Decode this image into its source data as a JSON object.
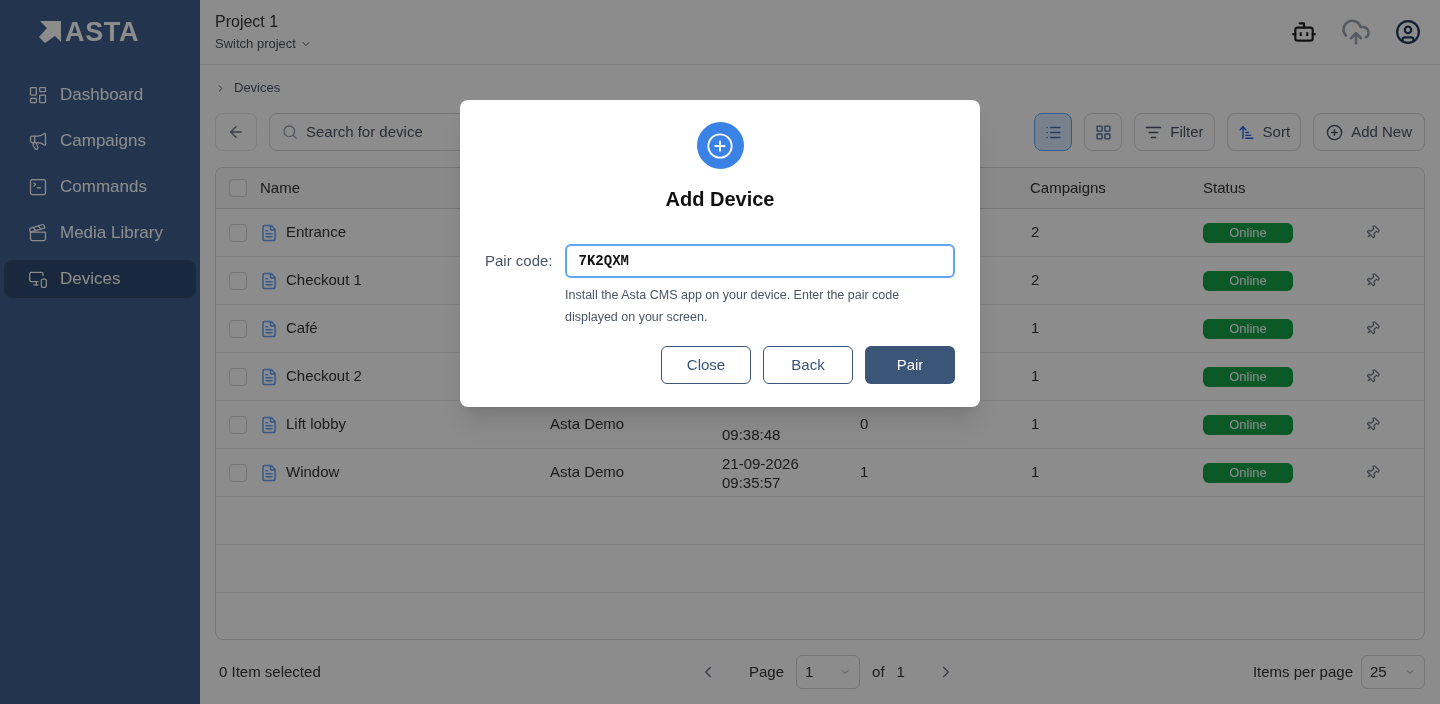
{
  "logo": {
    "text": "ASTA"
  },
  "sidebar": {
    "items": [
      {
        "label": "Dashboard",
        "kind": "dashboard",
        "selected": false
      },
      {
        "label": "Campaigns",
        "kind": "campaigns",
        "selected": false
      },
      {
        "label": "Commands",
        "kind": "commands",
        "selected": false
      },
      {
        "label": "Media Library",
        "kind": "media",
        "selected": false
      },
      {
        "label": "Devices",
        "kind": "devices",
        "selected": true
      }
    ]
  },
  "header": {
    "project": "Project 1",
    "switch": "Switch project"
  },
  "breadcrumb": "Devices",
  "toolbar": {
    "search": {
      "placeholder": "Search for device"
    },
    "views": [
      {
        "kind": "list",
        "selected": true
      },
      {
        "kind": "grid",
        "selected": false
      }
    ],
    "filter": "Filter",
    "sort": "Sort",
    "add": "Add New"
  },
  "table": {
    "header_checked": false,
    "columns": {
      "name": "Name",
      "campaigns": "Campaigns",
      "status": "Status"
    },
    "rows": [
      {
        "checked": false,
        "name": "Entrance",
        "campaigns": "2",
        "status": "Online"
      },
      {
        "checked": false,
        "name": "Checkout 1",
        "campaigns": "2",
        "status": "Online"
      },
      {
        "checked": false,
        "name": "Café",
        "campaigns": "1",
        "status": "Online"
      },
      {
        "checked": false,
        "name": "Checkout 2",
        "campaigns": "1",
        "status": "Online"
      },
      {
        "checked": false,
        "name": "Lift lobby",
        "column_2": "Asta Demo",
        "time": "09:38:48",
        "column_4": "0",
        "campaigns": "1",
        "status": "Online"
      },
      {
        "checked": false,
        "name": "Window",
        "column_2": "Asta Demo",
        "date": "21-09-2026",
        "time": "09:35:57",
        "column_4": "1",
        "campaigns": "1",
        "status": "Online"
      }
    ]
  },
  "footer": {
    "selected": "0 Item selected",
    "page_label": "Page",
    "page": "1",
    "of": "of",
    "pages": "1",
    "per_page_label": "Items per page",
    "per_page": "25"
  },
  "dialog": {
    "title": "Add Device",
    "label": "Pair code:",
    "value": "7K2QXM",
    "help": "Install the Asta CMS app on your device. Enter the pair code displayed on your screen.",
    "buttons": [
      {
        "label": "Close",
        "kind": "secondary"
      },
      {
        "label": "Back",
        "kind": "secondary"
      },
      {
        "label": "Pair",
        "kind": "primary"
      }
    ]
  }
}
